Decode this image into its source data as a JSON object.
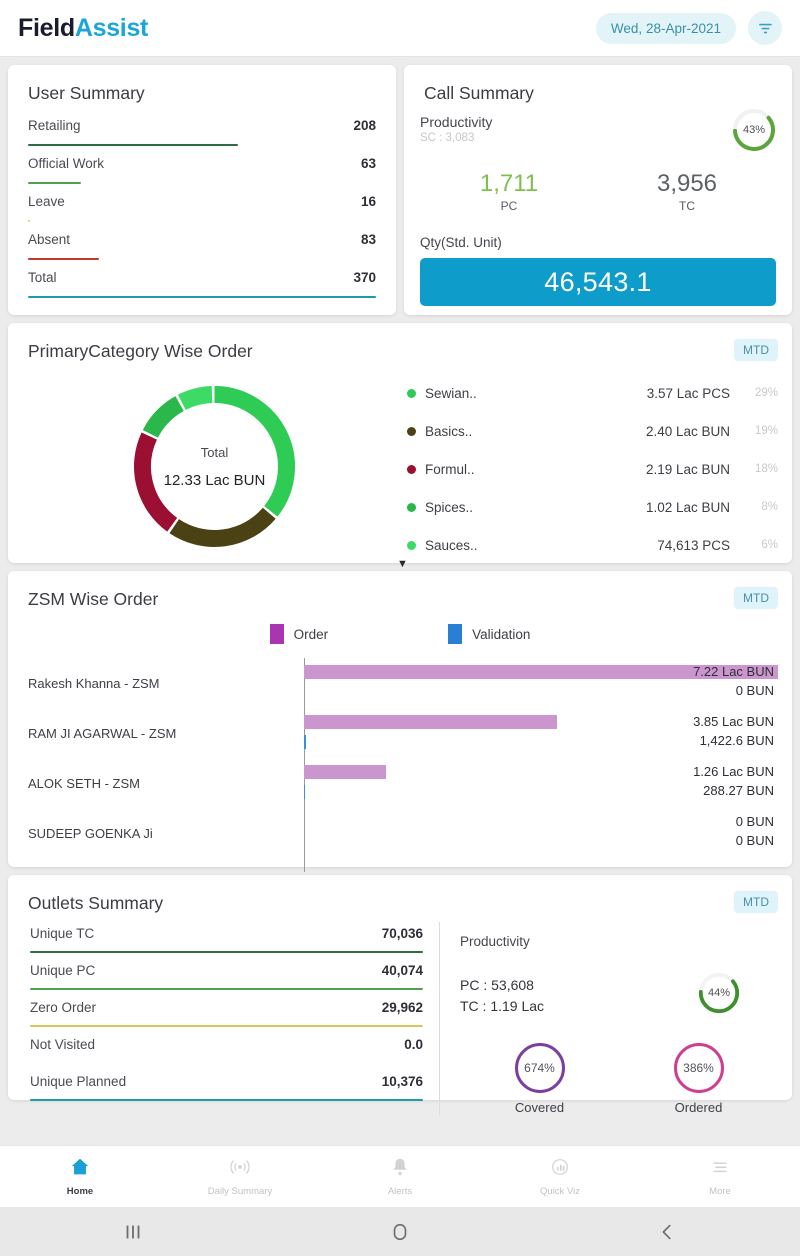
{
  "header": {
    "brand_field": "Field",
    "brand_assist": "Assist",
    "date": "Wed, 28-Apr-2021",
    "filter_icon": "filter-icon"
  },
  "user_summary": {
    "title": "User Summary",
    "rows": [
      {
        "label": "Retailing",
        "value": "208",
        "bar_color": "#2f6b43",
        "bar_width": "62%"
      },
      {
        "label": "Official Work",
        "value": "63",
        "bar_color": "#4fa052",
        "bar_width": "19%"
      },
      {
        "label": "Leave",
        "value": "16",
        "bar_color": "#e3cc63",
        "bar_width": "5%"
      },
      {
        "label": "Absent",
        "value": "83",
        "bar_color": "#c0392e",
        "bar_width": "24%"
      },
      {
        "label": "Total",
        "value": "370",
        "bar_color": "#1e9ba8",
        "bar_width": "100%"
      }
    ]
  },
  "call_summary": {
    "title": "Call Summary",
    "productivity_label": "Productivity",
    "sc_label": "SC : 3,083",
    "gauge_pct_label": "43%",
    "gauge_pct": 43,
    "gauge_color": "#5aa63c",
    "pc_value": "1,711",
    "pc_label": "PC",
    "tc_value": "3,956",
    "tc_label": "TC",
    "qty_label": "Qty(Std. Unit)",
    "qty_value": "46,543.1",
    "qty_bar_color": "#0e9ccb"
  },
  "category_order": {
    "title": "PrimaryCategory Wise Order",
    "badge": "MTD",
    "donut_center_label": "Total",
    "donut_center_value": "12.33 Lac BUN",
    "legend": [
      {
        "name": "Sewian..",
        "value": "3.57 Lac PCS",
        "pct": "29%",
        "color": "#2ecc55"
      },
      {
        "name": "Basics..",
        "value": "2.40 Lac BUN",
        "pct": "19%",
        "color": "#4a4214"
      },
      {
        "name": "Formul..",
        "value": "2.19 Lac BUN",
        "pct": "18%",
        "color": "#9b0f33"
      },
      {
        "name": "Spices..",
        "value": "1.02 Lac BUN",
        "pct": "8%",
        "color": "#2ab84a"
      },
      {
        "name": "Sauces..",
        "value": "74,613 PCS",
        "pct": "6%",
        "color": "#3ddb66"
      }
    ],
    "expand_icon": "chevron-down-icon",
    "chart_data": {
      "type": "pie",
      "title": "PrimaryCategory Wise Order",
      "categories": [
        "Sewian..",
        "Basics..",
        "Formul..",
        "Spices..",
        "Sauces.."
      ],
      "values": [
        29,
        19,
        18,
        8,
        6
      ],
      "colors": [
        "#2ecc55",
        "#4a4214",
        "#9b0f33",
        "#2ab84a",
        "#3ddb66"
      ],
      "total": "12.33 Lac BUN",
      "legend": "right"
    }
  },
  "zsm_order": {
    "title": "ZSM Wise Order",
    "badge": "MTD",
    "legend": [
      {
        "name": "Order",
        "color": "#a935b0"
      },
      {
        "name": "Validation",
        "color": "#2a7fd4"
      }
    ],
    "rows": [
      {
        "name": "Rakesh Khanna - ZSM",
        "order_label": "7.22 Lac BUN",
        "val_label": "0 BUN",
        "order_w": "100%",
        "val_w": "0%"
      },
      {
        "name": "RAM JI AGARWAL - ZSM",
        "order_label": "3.85 Lac BUN",
        "val_label": "1,422.6 BUN",
        "order_w": "53.3%",
        "val_w": "0.4%"
      },
      {
        "name": "ALOK SETH - ZSM",
        "order_label": "1.26 Lac BUN",
        "val_label": "288.27 BUN",
        "order_w": "17.4%",
        "val_w": "0.1%"
      },
      {
        "name": "SUDEEP GOENKA Ji",
        "order_label": "0 BUN",
        "val_label": "0 BUN",
        "order_w": "0%",
        "val_w": "0%"
      }
    ],
    "chart_data": {
      "type": "bar",
      "orientation": "horizontal",
      "title": "ZSM Wise Order",
      "categories": [
        "Rakesh Khanna - ZSM",
        "RAM JI AGARWAL - ZSM",
        "ALOK SETH - ZSM",
        "SUDEEP GOENKA Ji"
      ],
      "series": [
        {
          "name": "Order",
          "values": [
            722000,
            385000,
            126000,
            0
          ],
          "labels": [
            "7.22 Lac BUN",
            "3.85 Lac BUN",
            "1.26 Lac BUN",
            "0 BUN"
          ],
          "color": "#cb96cd"
        },
        {
          "name": "Validation",
          "values": [
            0,
            1422.6,
            288.27,
            0
          ],
          "labels": [
            "0 BUN",
            "1,422.6 BUN",
            "288.27 BUN",
            "0 BUN"
          ],
          "color": "#3b8fd8"
        }
      ],
      "xlabel": "",
      "ylabel": "",
      "grid": false,
      "legend": "top"
    }
  },
  "outlets_summary": {
    "title": "Outlets Summary",
    "badge": "MTD",
    "rows": [
      {
        "label": "Unique TC",
        "value": "70,036",
        "bar_color": "#2f6b43",
        "bar_width": "100%"
      },
      {
        "label": "Unique PC",
        "value": "40,074",
        "bar_color": "#4fa052",
        "bar_width": "100%"
      },
      {
        "label": "Zero Order",
        "value": "29,962",
        "bar_color": "#d6c65e",
        "bar_width": "100%"
      },
      {
        "label": "Not Visited",
        "value": "0.0",
        "bar_color": "transparent",
        "bar_width": "0%"
      },
      {
        "label": "Unique Planned",
        "value": "10,376",
        "bar_color": "#1e9ba8",
        "bar_width": "100%"
      }
    ],
    "productivity_label": "Productivity",
    "pc_line": "PC : 53,608",
    "tc_line": "TC : 1.19 Lac",
    "gauge_pct_label": "44%",
    "gauge_pct": 44,
    "gauge_color": "#3f8f2f",
    "rings": [
      {
        "value": "674%",
        "label": "Covered",
        "color": "#7b3fa0"
      },
      {
        "value": "386%",
        "label": "Ordered",
        "color": "#cf3f8f"
      }
    ]
  },
  "tabbar": {
    "items": [
      {
        "label": "Home",
        "icon": "home-icon",
        "active": true
      },
      {
        "label": "Daily Summary",
        "icon": "broadcast-icon",
        "active": false
      },
      {
        "label": "Alerts",
        "icon": "bell-icon",
        "active": false
      },
      {
        "label": "Quick Viz",
        "icon": "chart-bubble-icon",
        "active": false
      },
      {
        "label": "More",
        "icon": "hamburger-icon",
        "active": false
      }
    ]
  },
  "system_bar": {
    "recents": "recents-icon",
    "home": "home-circle-icon",
    "back": "back-icon"
  }
}
